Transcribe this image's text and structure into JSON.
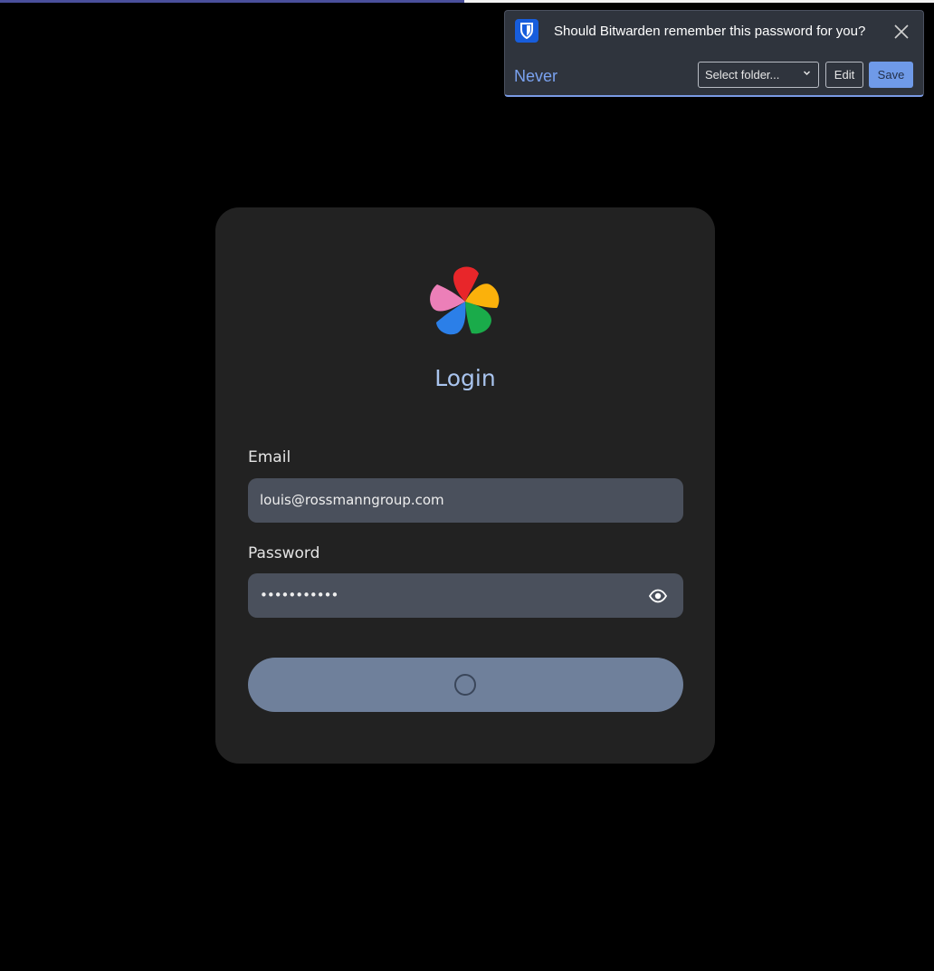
{
  "progress": {
    "fraction": 0.497,
    "fill_color": "#4a4f9c"
  },
  "bitwarden_bar": {
    "question": "Should Bitwarden remember this password for you?",
    "never_label": "Never",
    "folder_select_value": "Select folder...",
    "edit_label": "Edit",
    "save_label": "Save",
    "icons": {
      "logo": "bitwarden-shield-icon",
      "close": "close-icon",
      "select_chevron": "chevron-down-icon"
    },
    "colors": {
      "accent": "#7aa2f0",
      "save_bg": "#6f9ae8",
      "brand": "#175ddc"
    }
  },
  "login": {
    "title": "Login",
    "email_label": "Email",
    "email_value": "louis@rossmanngroup.com",
    "password_label": "Password",
    "password_value": "•••••••••••",
    "icons": {
      "app_logo": "flower-logo-icon",
      "toggle_password": "eye-icon",
      "loading": "loading-spinner-icon"
    },
    "colors": {
      "title": "#a9c4ee",
      "submit_bg": "#6f809b"
    }
  }
}
